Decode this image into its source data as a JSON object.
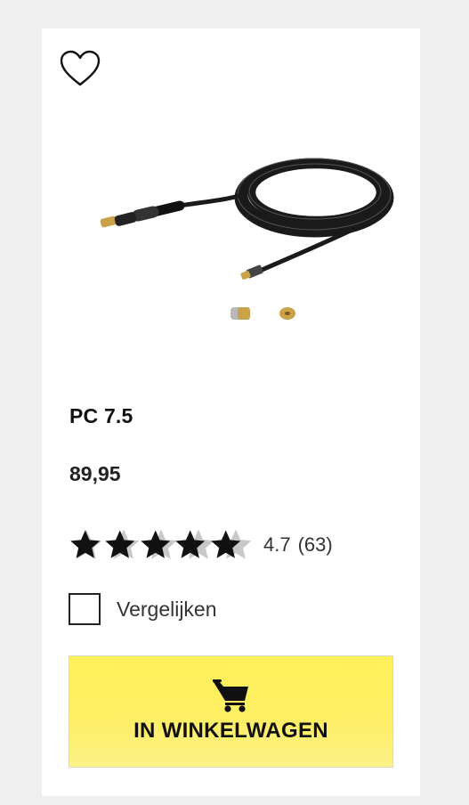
{
  "product": {
    "name": "PC 7.5",
    "price": "89,95",
    "image_icon": "hose-cable-product-image"
  },
  "rating": {
    "value": "4.7",
    "count": "(63)",
    "max": 5,
    "fraction": 0.94
  },
  "compare": {
    "label": "Vergelijken",
    "checked": false
  },
  "cart": {
    "label": "IN WINKELWAGEN",
    "icon": "shopping-cart-icon",
    "color": "#fdee5a"
  },
  "wishlist": {
    "icon": "heart-icon"
  }
}
